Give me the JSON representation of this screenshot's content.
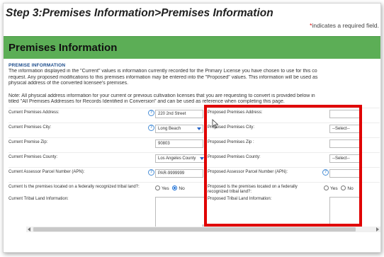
{
  "header": {
    "step_title": "Step 3:Premises Information>Premises Information",
    "required_star": "*",
    "required_note": "indicates a required field."
  },
  "section": {
    "title": "Premises Information",
    "subheading": "PREMISE INFORMATION",
    "paragraph1_line1": "The information displayed in the \"Current\" values is information currently recorded for the Primary License you have chosen to use for this co",
    "paragraph1_line2": "request. Any proposed modifications to this premises information may be entered into the \"Proposed\" values. This information will be used as",
    "paragraph1_line3": "physical address of the converted licensee's premises.",
    "paragraph2_line1": "Note: All physical address information for your current or previous cultivation licenses that you are requesting to convert is provided below in",
    "paragraph2_line2": "titled \"All Premises Addresses for Records Identified in Conversion\" and can be used as reference when completing this page."
  },
  "current": {
    "address_label": "Current Premises Address:",
    "address_value": "220 2nd Street",
    "city_label": "Current Premises City:",
    "city_value": "Long Beach",
    "zip_label": "Current Premise Zip:",
    "zip_value": "90803",
    "county_label": "Current Premises County:",
    "county_value": "Los Angeles County",
    "apn_label": "Current Assessor Parcel Number (APN):",
    "apn_value": "PAR-9999999",
    "tribal_label": "Current Is the premises located on a federally recognized tribal land?:",
    "tribal_yes": "Yes",
    "tribal_no": "No",
    "tribal_info_label": "Current Tribal Land Information:"
  },
  "proposed": {
    "address_label": "Proposed Premises Address:",
    "city_label": "Proposed Premises City:",
    "city_select": "--Select--",
    "zip_label": "Proposed Premises Zip :",
    "county_label": "Proposed Premises County:",
    "county_select": "--Select--",
    "apn_label": "Proposed Assessor Parcel Number (APN):",
    "tribal_label": "Proposed Is the premises located on a federally recognized tribal land?:",
    "tribal_yes": "Yes",
    "tribal_no": "No",
    "tribal_info_label": "Proposed Tribal Land Information:"
  },
  "icons": {
    "help": "?",
    "help_color": "#4a8fd6",
    "highlight_color": "#e00000",
    "header_color": "#5cae56"
  }
}
